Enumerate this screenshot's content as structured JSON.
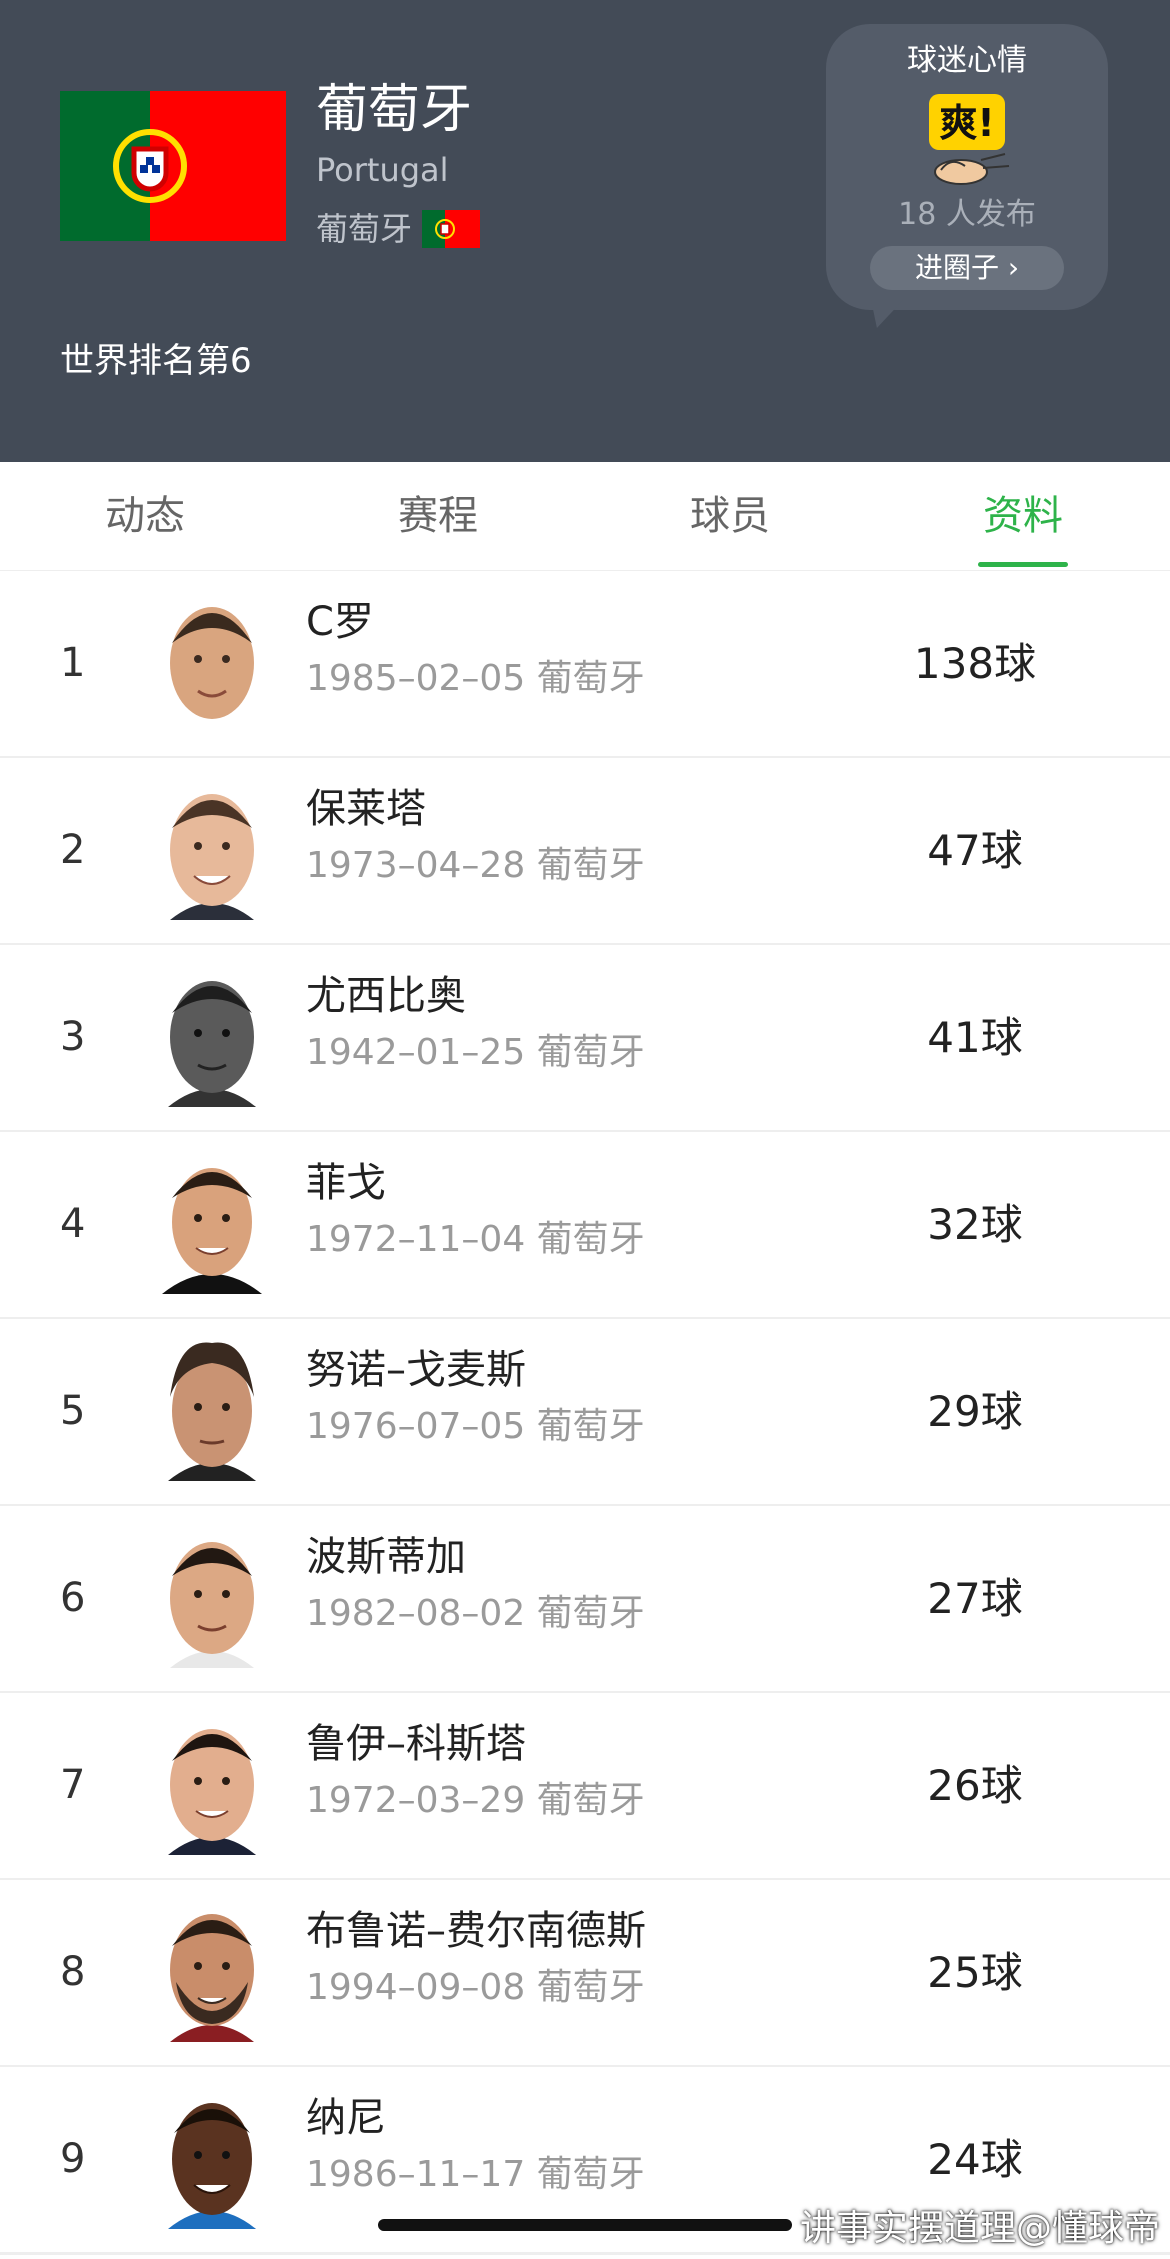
{
  "header": {
    "team_name": "葡萄牙",
    "team_name_en": "Portugal",
    "country_label": "葡萄牙",
    "world_rank": "世界排名第6",
    "colors": {
      "background": "#434b57",
      "flag_green": "#006b2d",
      "flag_red": "#ff0000",
      "accent": "#2eb34a"
    }
  },
  "mood": {
    "title": "球迷心情",
    "emoji_text": "爽!",
    "count": "18 人发布",
    "button_label": "进圈子 ›"
  },
  "tabs": [
    {
      "label": "动态",
      "active": false
    },
    {
      "label": "赛程",
      "active": false
    },
    {
      "label": "球员",
      "active": false
    },
    {
      "label": "资料",
      "active": true
    }
  ],
  "players": [
    {
      "rank": "1",
      "name": "C罗",
      "info": "1985–02–05 葡萄牙",
      "goals": "138球",
      "avatar": "avatar-icon"
    },
    {
      "rank": "2",
      "name": "保莱塔",
      "info": "1973–04–28 葡萄牙",
      "goals": "47球",
      "avatar": "avatar-icon"
    },
    {
      "rank": "3",
      "name": "尤西比奥",
      "info": "1942–01–25 葡萄牙",
      "goals": "41球",
      "avatar": "avatar-icon"
    },
    {
      "rank": "4",
      "name": "菲戈",
      "info": "1972–11–04 葡萄牙",
      "goals": "32球",
      "avatar": "avatar-icon"
    },
    {
      "rank": "5",
      "name": "努诺–戈麦斯",
      "info": "1976–07–05 葡萄牙",
      "goals": "29球",
      "avatar": "avatar-icon"
    },
    {
      "rank": "6",
      "name": "波斯蒂加",
      "info": "1982–08–02 葡萄牙",
      "goals": "27球",
      "avatar": "avatar-icon"
    },
    {
      "rank": "7",
      "name": "鲁伊–科斯塔",
      "info": "1972–03–29 葡萄牙",
      "goals": "26球",
      "avatar": "avatar-icon"
    },
    {
      "rank": "8",
      "name": "布鲁诺–费尔南德斯",
      "info": "1994–09–08 葡萄牙",
      "goals": "25球",
      "avatar": "avatar-icon"
    },
    {
      "rank": "9",
      "name": "纳尼",
      "info": "1986–11–17 葡萄牙",
      "goals": "24球",
      "avatar": "avatar-icon"
    }
  ],
  "watermark": "讲事实摆道理@懂球帝"
}
